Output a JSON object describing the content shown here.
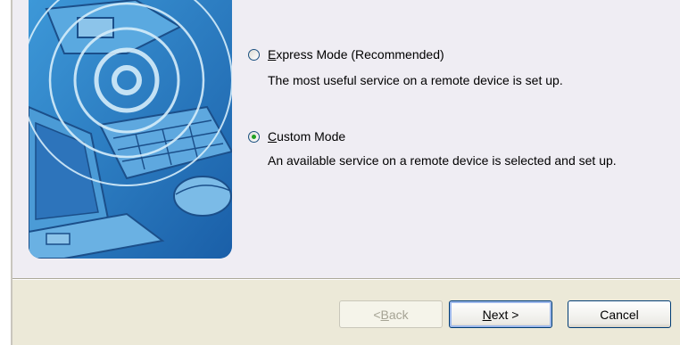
{
  "options": [
    {
      "label_mnemonic": "E",
      "label_rest": "xpress Mode (Recommended)",
      "description": "The most useful service on a remote device is set up.",
      "checked": false
    },
    {
      "label_mnemonic": "C",
      "label_rest": "ustom Mode",
      "description": "An available service on a remote device is selected and set up.",
      "checked": true
    }
  ],
  "buttons": {
    "back_prefix": "< ",
    "back_mnemonic": "B",
    "back_rest": "ack",
    "back_enabled": false,
    "next_mnemonic": "N",
    "next_rest": "ext >",
    "cancel_label": "Cancel"
  },
  "colors": {
    "panel_bg": "#efedf3",
    "dialog_bg": "#ece9d8",
    "art_blue": "#2b7fc6",
    "radio_dot": "#21a121"
  }
}
